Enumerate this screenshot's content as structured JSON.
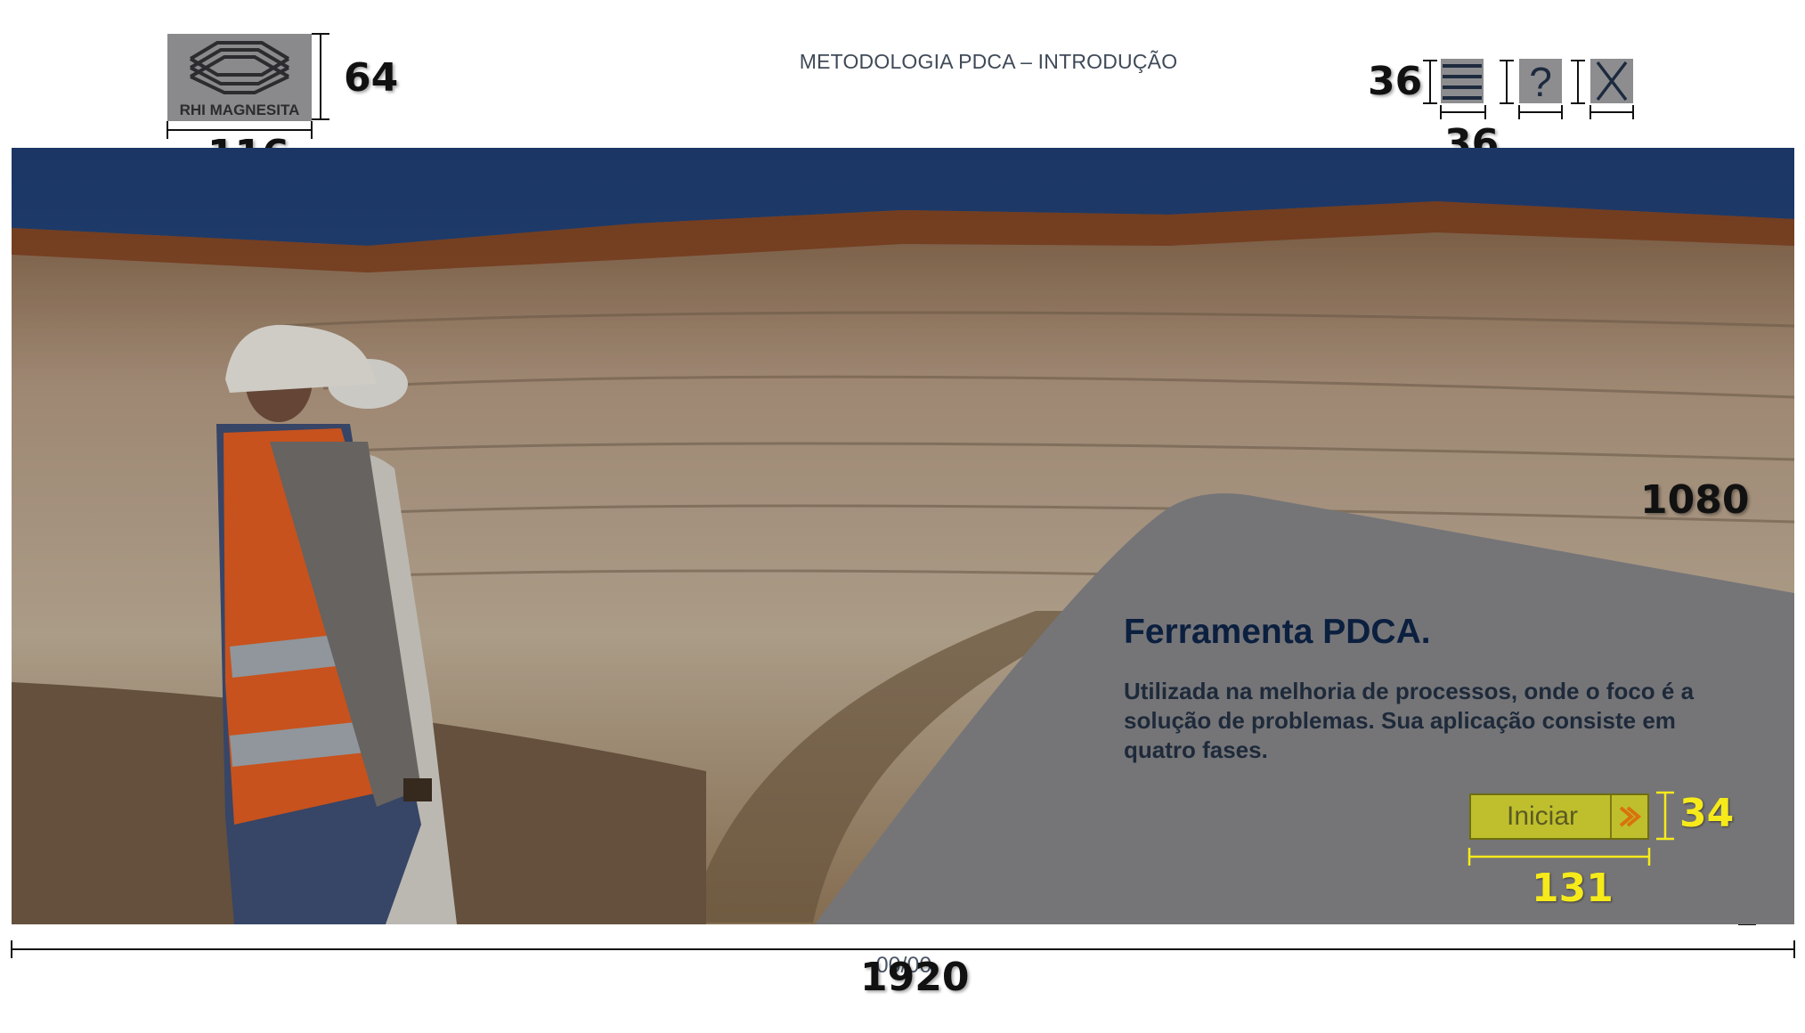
{
  "header": {
    "logo_text": "RHI MAGNESITA",
    "title": "METODOLOGIA PDCA – INTRODUÇÃO"
  },
  "toolbar": {
    "menu_icon": "hamburger-icon",
    "help_icon": "question-mark-icon",
    "close_icon": "close-x-icon"
  },
  "card": {
    "title": "Ferramenta PDCA.",
    "body": "Utilizada na melhoria de processos, onde o foco é a solução de problemas. Sua aplicação consiste em quatro fases."
  },
  "start_button": {
    "label": "Iniciar",
    "icon": "double-chevron-right-icon"
  },
  "footer": {
    "page_counter": "00/00"
  },
  "annotations": {
    "logo_height": "64",
    "logo_width": "116",
    "icon_height": "36",
    "icon_width": "36",
    "content_height": "1080",
    "content_width": "1920",
    "button_height": "34",
    "button_width": "131"
  },
  "colors": {
    "card_gray": "#7d7d80",
    "button_fill": "#bfbf2e",
    "annotation_yellow": "#f6ea1a",
    "title_navy": "#0b1f3f"
  }
}
